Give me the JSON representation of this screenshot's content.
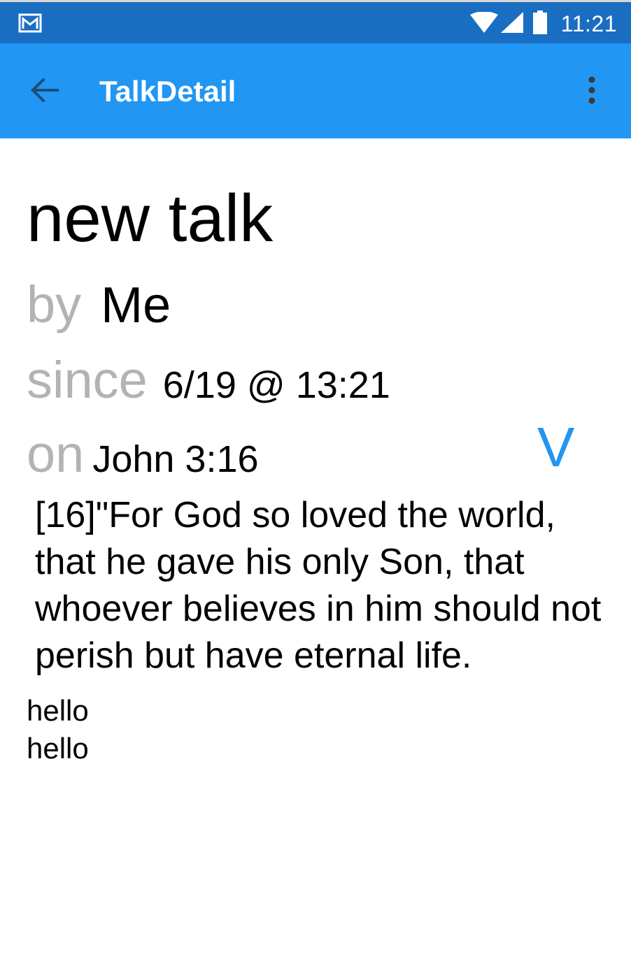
{
  "status_bar": {
    "time": "11:21",
    "icons": [
      "gmail-icon",
      "wifi-icon",
      "signal-icon",
      "battery-icon"
    ]
  },
  "app_bar": {
    "title": "TalkDetail",
    "back_icon": "arrow-back-icon",
    "menu_icon": "more-vert-icon"
  },
  "talk": {
    "title": "new talk",
    "by_label": "by",
    "author": "Me",
    "since_label": "since",
    "date": "6/19 @ 13:21",
    "on_label": "on",
    "reference": "John 3:16",
    "v_button": "V",
    "verse": "[16]\"For God so loved the world, that he gave his only Son, that whoever believes in him should not perish but have eternal life.",
    "comments": [
      "hello",
      "hello"
    ]
  },
  "colors": {
    "status_bar": "#1a6ec2",
    "app_bar": "#2196f3",
    "accent": "#2196f3",
    "muted_label": "#b3b3b3"
  }
}
